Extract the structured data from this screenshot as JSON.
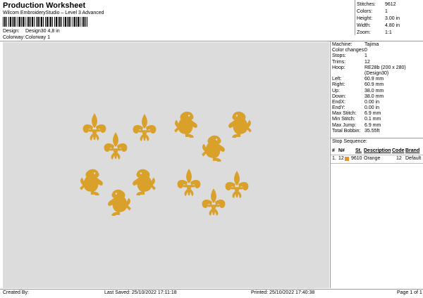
{
  "header": {
    "title": "Production Worksheet",
    "subtitle": "Wilcom EmbroideryStudio – Level 3 Advanced",
    "design_label": "Design:",
    "design_value": "Design30 4,8 in",
    "colorway_label": "Colorway:",
    "colorway_value": "Colorway 1"
  },
  "stats": [
    {
      "k": "Stitches:",
      "v": "9612"
    },
    {
      "k": "Colors:",
      "v": "1"
    },
    {
      "k": "Height:",
      "v": "3.00 in"
    },
    {
      "k": "Width:",
      "v": "4.80 in"
    },
    {
      "k": "Zoom:",
      "v": "1:1"
    }
  ],
  "panel": [
    {
      "k": "Machine:",
      "v": "Tajima"
    },
    {
      "k": "Color changes:",
      "v": "0"
    },
    {
      "k": "Stops:",
      "v": "1"
    },
    {
      "k": "Trims:",
      "v": "12"
    },
    {
      "k": "Hoop:",
      "v": "RE28b (200 x 280)"
    },
    {
      "k": "",
      "v": "(Design30)"
    },
    {
      "k": "Left:",
      "v": "60.9 mm"
    },
    {
      "k": "Right:",
      "v": "60.9 mm"
    },
    {
      "k": "Up:",
      "v": "38.0 mm"
    },
    {
      "k": "Down:",
      "v": "38.0 mm"
    },
    {
      "k": "EndX:",
      "v": "0.00 in"
    },
    {
      "k": "EndY:",
      "v": "0.00 in"
    },
    {
      "k": "Max Stitch:",
      "v": "6.9 mm"
    },
    {
      "k": "Min Stitch:",
      "v": "0.1 mm"
    },
    {
      "k": "Max Jump:",
      "v": "6.9 mm"
    },
    {
      "k": "Total Bobbin:",
      "v": "35.55ft"
    }
  ],
  "stop_sequence": {
    "label": "Stop Sequence:",
    "headers": {
      "num": "#",
      "n": "N#",
      "st": "St.",
      "desc": "Description",
      "code": "Code",
      "brand": "Brand"
    },
    "rows": [
      {
        "num": "1.",
        "n": "12",
        "st": "9610",
        "desc": "Orange",
        "code": "12",
        "brand": "Default",
        "color": "#e8922e"
      }
    ]
  },
  "footer": {
    "created_by": "Created By:",
    "last_saved": "Last Saved: 25/10/2022 17:11:18",
    "printed": "Printed: 25/10/2022 17:40:38",
    "page": "Page 1 of 1"
  },
  "motif_color": "#d9a02a",
  "motifs": [
    {
      "type": "fleur"
    },
    {
      "type": "fleur"
    },
    {
      "type": "fleur"
    },
    {
      "type": "lion"
    },
    {
      "type": "lion"
    },
    {
      "type": "lion"
    },
    {
      "type": "lion"
    },
    {
      "type": "lion"
    },
    {
      "type": "lion"
    },
    {
      "type": "fleur"
    },
    {
      "type": "fleur"
    },
    {
      "type": "fleur"
    }
  ]
}
